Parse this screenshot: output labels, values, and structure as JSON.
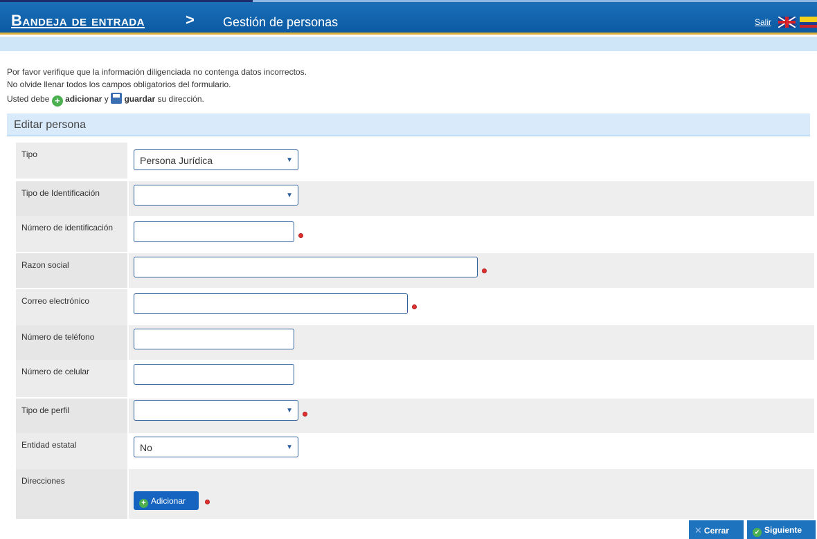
{
  "header": {
    "home_label": "Bandeja de entrada",
    "separator": ">",
    "current_page": "Gestión de personas",
    "logout_label": "Salir",
    "colors": {
      "bar": "#0b5aa3",
      "accent_line": "#e0b03c",
      "subbar": "#cfe5f8"
    }
  },
  "instructions": {
    "line1": "Por favor verifique que la información diligenciada no contenga datos incorrectos.",
    "line2": "No olvide llenar todos los campos obligatorios del formulario.",
    "line3_prefix": "Usted debe",
    "line3_add": "adicionar",
    "line3_and": "y",
    "line3_save": "guardar",
    "line3_suffix": "su dirección."
  },
  "section": {
    "title": "Editar persona"
  },
  "form": {
    "tipo": {
      "label": "Tipo",
      "value": "Persona Jurídica"
    },
    "tipo_identificacion": {
      "label": "Tipo de Identificación",
      "value": ""
    },
    "numero_identificacion": {
      "label": "Número de identificación",
      "value": ""
    },
    "razon_social": {
      "label": "Razon social",
      "value": ""
    },
    "correo": {
      "label": "Correo electrónico",
      "value": ""
    },
    "telefono": {
      "label": "Número de teléfono",
      "value": ""
    },
    "celular": {
      "label": "Número de celular",
      "value": ""
    },
    "tipo_perfil": {
      "label": "Tipo de perfil",
      "value": ""
    },
    "entidad_estatal": {
      "label": "Entidad estatal",
      "value": "No"
    },
    "direcciones": {
      "label": "Direcciones",
      "add_button": "Adicionar"
    }
  },
  "footer": {
    "close_button": "Cerrar",
    "next_button": "Siguiente"
  }
}
